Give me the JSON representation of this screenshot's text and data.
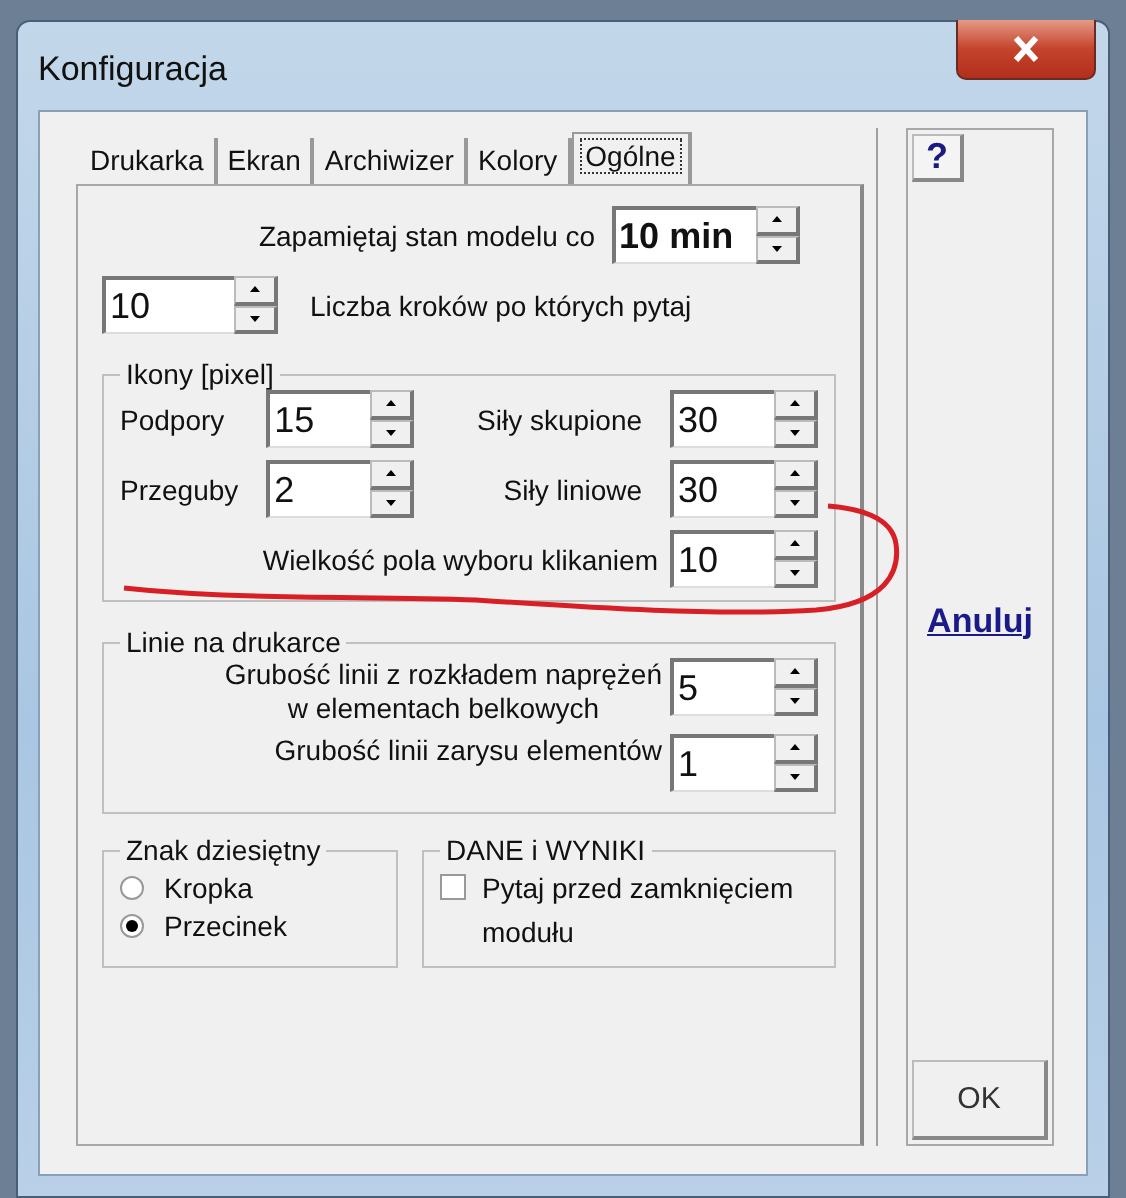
{
  "window": {
    "title": "Konfiguracja"
  },
  "tabs": [
    {
      "label": "Drukarka",
      "selected": false
    },
    {
      "label": "Ekran",
      "selected": false
    },
    {
      "label": "Archiwizer",
      "selected": false
    },
    {
      "label": "Kolory",
      "selected": false
    },
    {
      "label": "Ogólne",
      "selected": true
    }
  ],
  "autosave": {
    "label": "Zapamiętaj stan modelu co",
    "value": "10 min"
  },
  "steps": {
    "value": "10",
    "label": "Liczba kroków po których pytaj"
  },
  "icons_group": {
    "title": "Ikony [pixel]",
    "fields": [
      {
        "label": "Podpory",
        "value": "15"
      },
      {
        "label": "Siły skupione",
        "value": "30"
      },
      {
        "label": "Przeguby",
        "value": "2"
      },
      {
        "label": "Siły liniowe",
        "value": "30"
      }
    ],
    "pick_size": {
      "label": "Wielkość pola wyboru klikaniem",
      "value": "10"
    }
  },
  "print_lines": {
    "title": "Linie na drukarce",
    "fields": [
      {
        "label": "Grubość linii z rozkładem naprężeń\nw elementach belkowych",
        "value": "5"
      },
      {
        "label": "Grubość linii zarysu elementów",
        "value": "1"
      }
    ]
  },
  "decimal": {
    "title": "Znak dziesiętny",
    "options": [
      {
        "label": "Kropka",
        "selected": false
      },
      {
        "label": "Przecinek",
        "selected": true
      }
    ]
  },
  "data_results": {
    "title": "DANE i WYNIKI",
    "checkbox": {
      "label": "Pytaj przed zamknięciem modułu",
      "checked": false
    }
  },
  "side": {
    "help": "?",
    "cancel": "Anuluj",
    "ok": "OK"
  }
}
